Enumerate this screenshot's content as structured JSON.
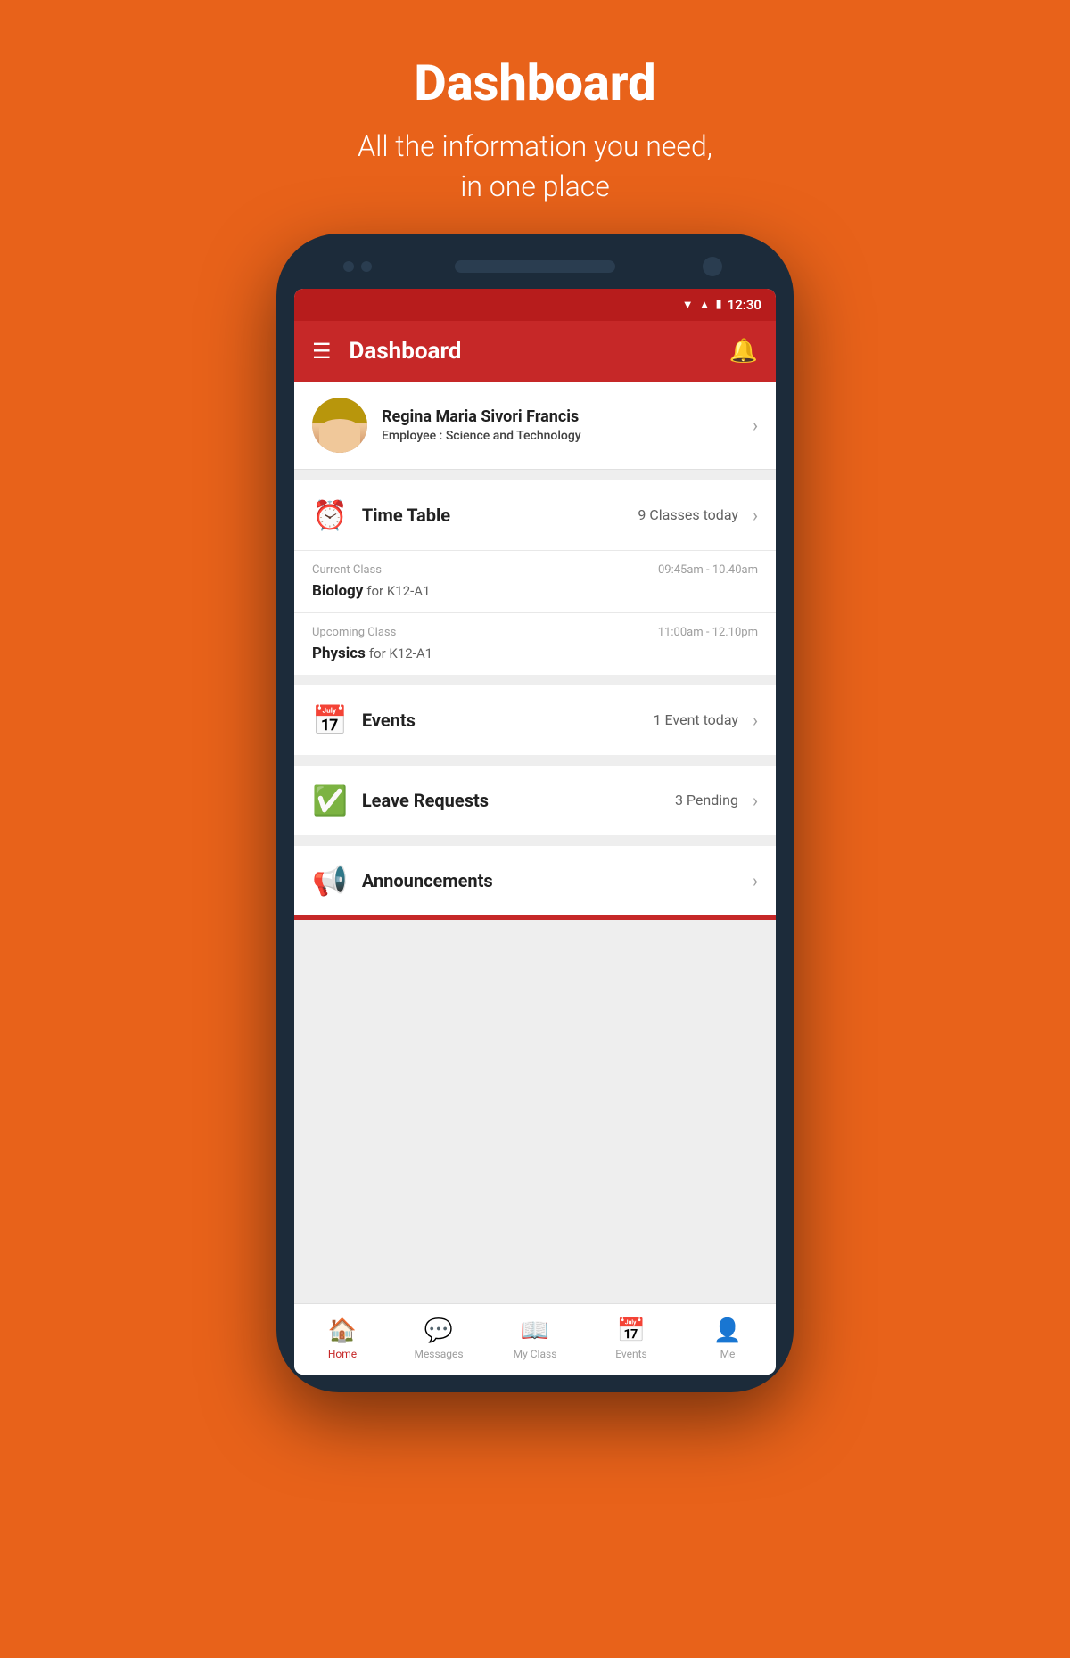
{
  "header": {
    "title": "Dashboard",
    "subtitle_line1": "All the information you need,",
    "subtitle_line2": "in one place"
  },
  "status_bar": {
    "time": "12:30"
  },
  "app_bar": {
    "title": "Dashboard",
    "menu_icon": "☰",
    "bell_icon": "🔔"
  },
  "user": {
    "name": "Regina Maria Sivori Francis",
    "role_label": "Employee : ",
    "role_value": "Science and Technology"
  },
  "timetable": {
    "icon": "⏰",
    "title": "Time Table",
    "count": "9 Classes today",
    "current_class": {
      "label": "Current Class",
      "time": "09:45am - 10.40am",
      "subject": "Biology",
      "group": "for K12-A1"
    },
    "upcoming_class": {
      "label": "Upcoming Class",
      "time": "11:00am - 12.10pm",
      "subject": "Physics",
      "group": "for K12-A1"
    }
  },
  "events": {
    "icon": "📅",
    "title": "Events",
    "count": "1 Event today"
  },
  "leave_requests": {
    "icon": "✅",
    "title": "Leave Requests",
    "count": "3 Pending"
  },
  "announcements": {
    "icon": "📢",
    "title": "Announcements",
    "count": ""
  },
  "bottom_nav": {
    "items": [
      {
        "label": "Home",
        "icon": "🏠",
        "active": true
      },
      {
        "label": "Messages",
        "icon": "💬",
        "active": false
      },
      {
        "label": "My Class",
        "icon": "📖",
        "active": false
      },
      {
        "label": "Events",
        "icon": "📅",
        "active": false
      },
      {
        "label": "Me",
        "icon": "👤",
        "active": false
      }
    ]
  }
}
